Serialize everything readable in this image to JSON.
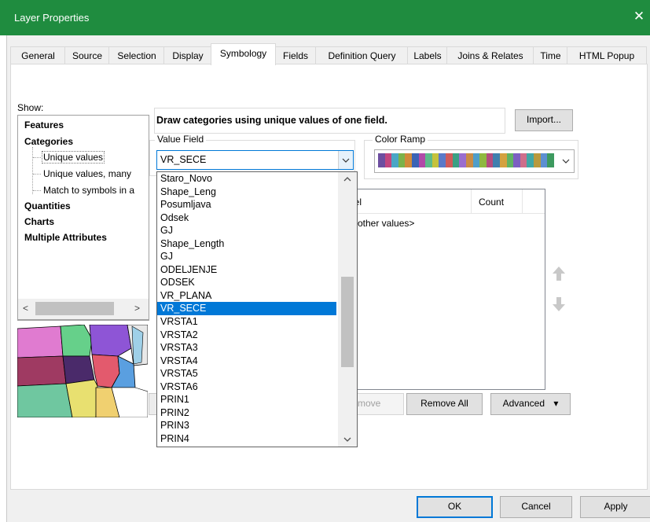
{
  "window": {
    "title": "Layer Properties",
    "close_glyph": "✕"
  },
  "tabs": [
    "General",
    "Source",
    "Selection",
    "Display",
    "Symbology",
    "Fields",
    "Definition Query",
    "Labels",
    "Joins & Relates",
    "Time",
    "HTML Popup"
  ],
  "show": {
    "label": "Show:",
    "items": [
      "Features",
      "Categories",
      "Unique values",
      "Unique values, many",
      "Match to symbols in a",
      "Quantities",
      "Charts",
      "Multiple Attributes"
    ],
    "scroll_left": "<",
    "scroll_right": ">"
  },
  "description": "Draw categories using unique values of one field.",
  "import_label": "Import...",
  "value_field": {
    "label": "Value Field",
    "selected": "VR_SECE"
  },
  "color_ramp": {
    "label": "Color Ramp",
    "colors": [
      "#6d4ea0",
      "#c2467f",
      "#4aa6c6",
      "#7bb24a",
      "#d08a3a",
      "#3b63b5",
      "#b14aa8",
      "#5dbb8b",
      "#c5c23c",
      "#5a79c9",
      "#cf5b5b",
      "#3aa083",
      "#9a6dcf",
      "#c98c46",
      "#4f9ec9",
      "#8fb83f",
      "#b34d7e",
      "#3f7fae",
      "#d4a13f",
      "#61b363",
      "#7c5fc2",
      "#ce6e8b",
      "#41a7a6",
      "#b89a3d",
      "#5c8fd1",
      "#3d9a5f"
    ]
  },
  "dropdown_items": [
    "Staro_Novo",
    "Shape_Leng",
    "Posumljava",
    "Odsek",
    "GJ",
    "Shape_Length",
    "GJ",
    "ODELJENJE",
    "ODSEK",
    "VR_PLANA",
    "VR_SECE",
    "VRSTA1",
    "VRSTA2",
    "VRSTA3",
    "VRSTA4",
    "VRSTA5",
    "VRSTA6",
    "PRIN1",
    "PRIN2",
    "PRIN3",
    "PRIN4"
  ],
  "dropdown_selected_index": 10,
  "table": {
    "col_label": "bel",
    "col_count": "Count",
    "row1": "other values>"
  },
  "buttons": {
    "remove": "move",
    "remove_all": "Remove All",
    "advanced": "Advanced",
    "advanced_arrow": "▾",
    "ok": "OK",
    "cancel": "Cancel",
    "apply": "Apply"
  },
  "icons": {
    "up": "up-arrow-icon",
    "down": "down-arrow-icon"
  }
}
